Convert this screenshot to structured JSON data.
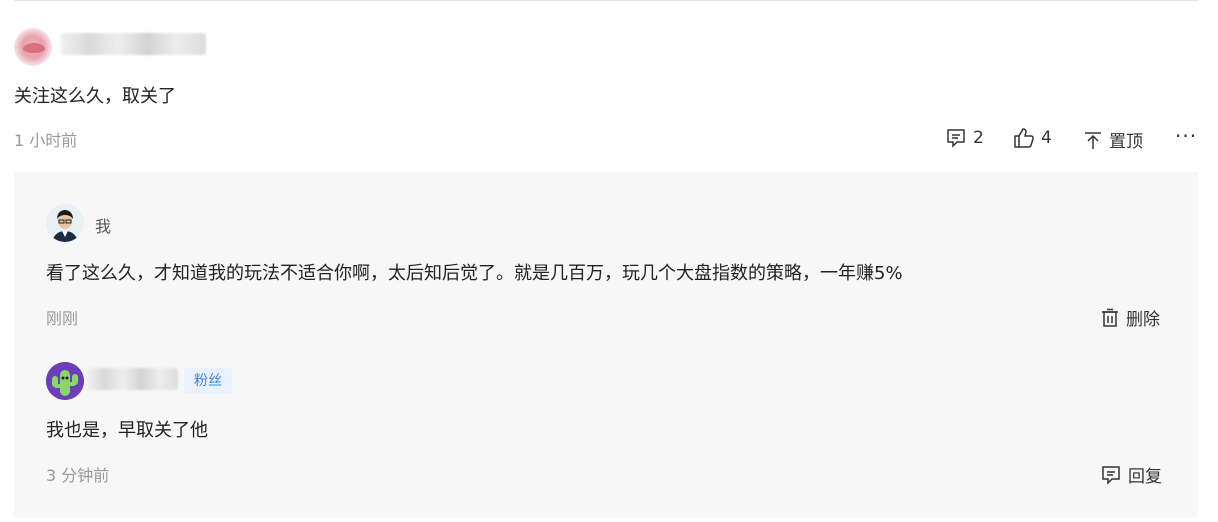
{
  "main_comment": {
    "content": "关注这么久，取关了",
    "time": "1 小时前",
    "actions": {
      "reply_count": "2",
      "like_count": "4",
      "pin_label": "置顶",
      "more_label": "···"
    }
  },
  "replies": [
    {
      "author": "我",
      "content": "看了这么久，才知道我的玩法不适合你啊，太后知后觉了。就是几百万，玩几个大盘指数的策略，一年赚5%",
      "time": "刚刚",
      "action_label": "删除"
    },
    {
      "badge": "粉丝",
      "content": "我也是，早取关了他",
      "time": "3 分钟前",
      "action_label": "回复"
    }
  ],
  "icons": {
    "comment": "comment-icon",
    "like": "thumbs-up-icon",
    "pin": "pin-top-icon",
    "delete": "trash-icon",
    "reply": "reply-icon"
  },
  "colors": {
    "meta_text": "#999999",
    "reply_bg": "#f7f7f7",
    "badge_text": "#3a86e0",
    "badge_bg": "#e8f1fc"
  }
}
